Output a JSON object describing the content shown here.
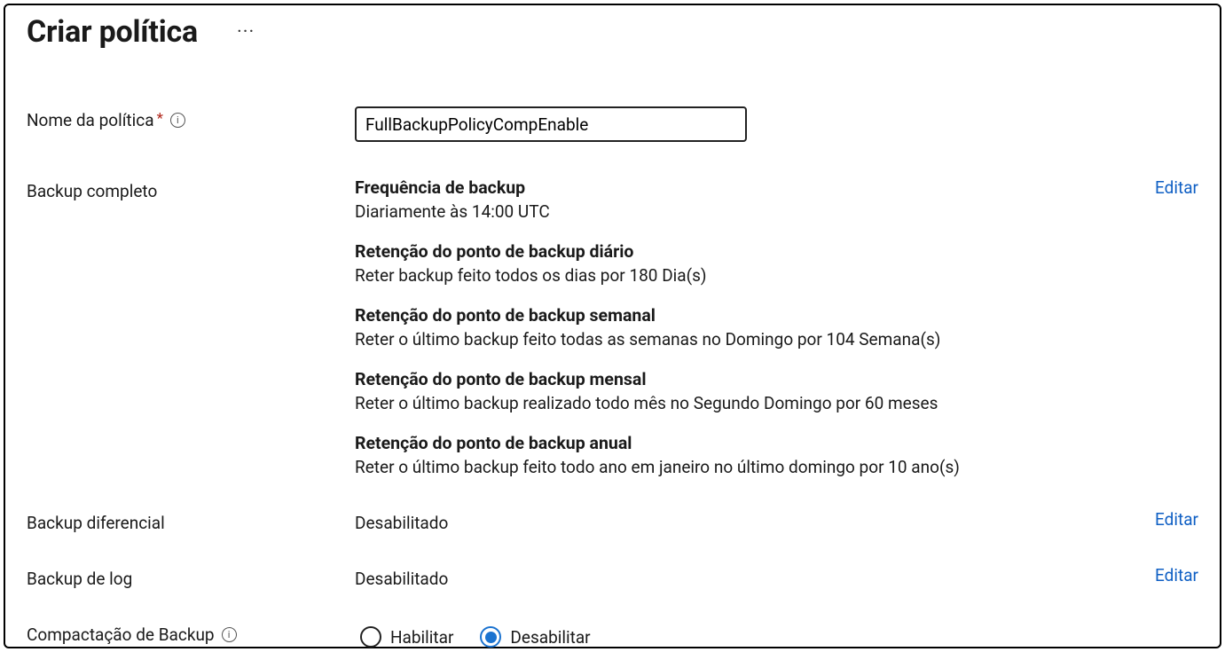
{
  "header": {
    "title": "Criar política"
  },
  "fields": {
    "policy_name_label": "Nome da política",
    "policy_name_value": "FullBackupPolicyCompEnable",
    "full_backup_label": "Backup completo",
    "diff_backup_label": "Backup diferencial",
    "log_backup_label": "Backup de log",
    "compression_label": "Compactação de Backup"
  },
  "full_backup": {
    "freq_title": "Frequência de backup",
    "freq_value": "Diariamente às 14:00 UTC",
    "daily_title": "Retenção do ponto de backup diário",
    "daily_value": "Reter backup feito todos os dias por 180 Dia(s)",
    "weekly_title": "Retenção do ponto de backup semanal",
    "weekly_value": "Reter o último backup feito todas as semanas no Domingo por 104 Semana(s)",
    "monthly_title": "Retenção do ponto de backup mensal",
    "monthly_value": "Reter o último backup realizado todo mês no Segundo Domingo por 60 meses",
    "yearly_title": "Retenção do ponto de backup anual",
    "yearly_value": "Reter o último backup feito todo ano em janeiro no último domingo por 10 ano(s)"
  },
  "diff_backup_status": "Desabilitado",
  "log_backup_status": "Desabilitado",
  "compression": {
    "enable_label": "Habilitar",
    "disable_label": "Desabilitar",
    "selected": "disable"
  },
  "actions": {
    "edit": "Editar"
  }
}
